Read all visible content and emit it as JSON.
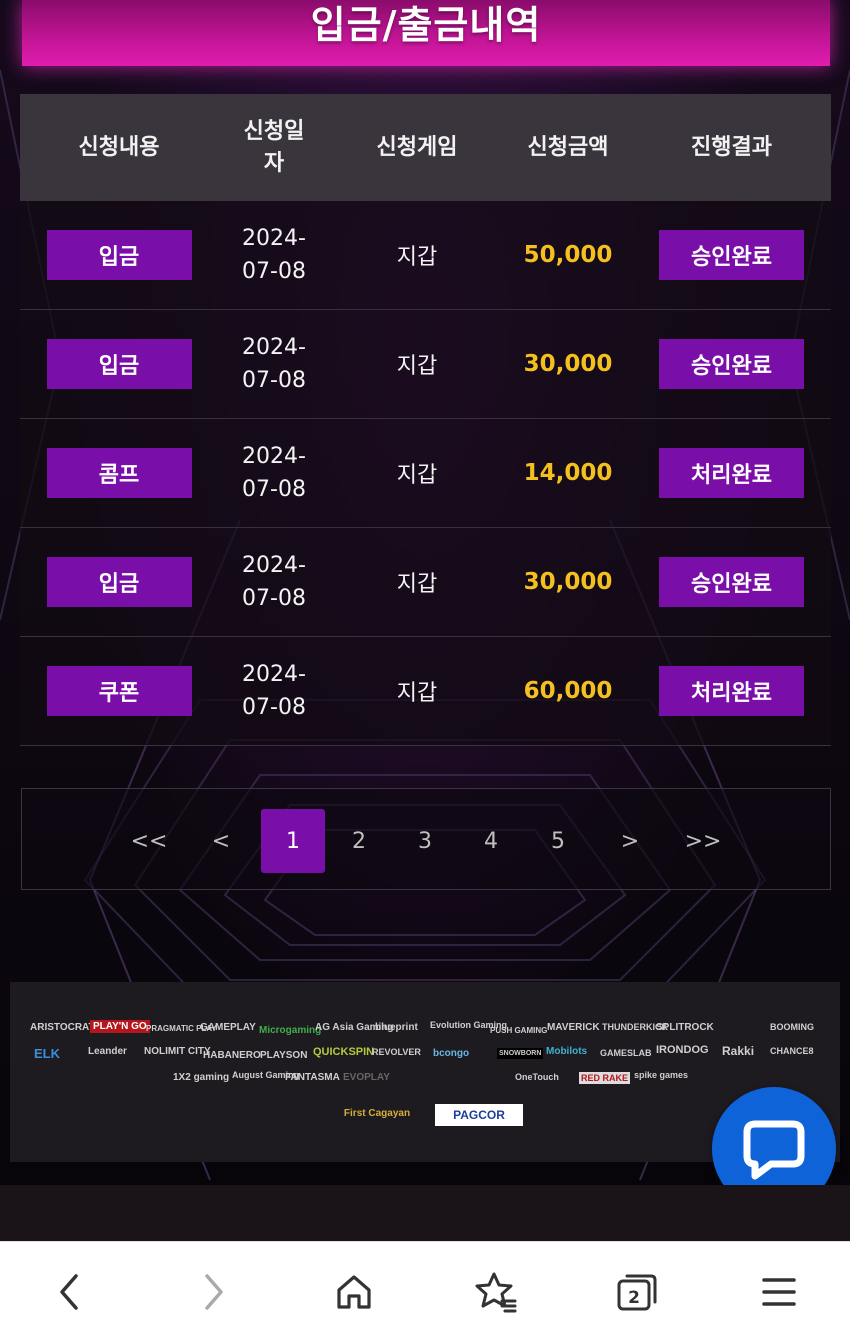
{
  "title": "입금/출금내역",
  "table": {
    "headers": [
      "신청내용",
      "신청일자",
      "신청게임",
      "신청금액",
      "진행결과"
    ],
    "rows": [
      {
        "type": "입금",
        "date": "2024-07-08",
        "game": "지갑",
        "amount": "50,000",
        "result": "승인완료"
      },
      {
        "type": "입금",
        "date": "2024-07-08",
        "game": "지갑",
        "amount": "30,000",
        "result": "승인완료"
      },
      {
        "type": "콤프",
        "date": "2024-07-08",
        "game": "지갑",
        "amount": "14,000",
        "result": "처리완료"
      },
      {
        "type": "입금",
        "date": "2024-07-08",
        "game": "지갑",
        "amount": "30,000",
        "result": "승인완료"
      },
      {
        "type": "쿠폰",
        "date": "2024-07-08",
        "game": "지갑",
        "amount": "60,000",
        "result": "처리완료"
      }
    ]
  },
  "pagination": {
    "first": "<<",
    "prev": "<",
    "pages": [
      "1",
      "2",
      "3",
      "4",
      "5"
    ],
    "current": "1",
    "next": ">",
    "last": ">>"
  },
  "partners": {
    "row1": [
      "ARISTOCRAT",
      "PLAY'N GO",
      "PRAGMATIC PLAY",
      "GAMEPLAY",
      "Microgaming",
      "AG Asia Gaming",
      "blueprint",
      "Evolution Gaming",
      "PUSH GAMING",
      "MAVERICK",
      "THUNDERKICK",
      "SPLITROCK",
      "BOOMING"
    ],
    "row2": [
      "ELK",
      "Leander",
      "NOLIMIT CITY",
      "HABANERO",
      "PLAYSON",
      "QUICKSPIN",
      "REVOLVER",
      "bcongo",
      "SNOWBORN",
      "Mobilots",
      "GAMESLAB",
      "IRONDOG",
      "Rakki",
      "CHANCE8"
    ],
    "row3": [
      "1X2 gaming",
      "August Gaming",
      "FANTASMA",
      "EVOPLAY",
      "OneTouch",
      "RED RAKE",
      "spike games"
    ],
    "licenses": [
      "First Cagayan",
      "PAGCOR"
    ]
  },
  "colors": {
    "accent": "#7a0ea8",
    "title_gradient": "#e01cae",
    "amount": "#f4c01e",
    "header_bg": "#3a343c",
    "chat_button": "#0e63d8"
  },
  "icons": {
    "chat": "chat-bubble-icon",
    "nav": [
      "back-arrow-icon",
      "forward-arrow-icon",
      "home-icon",
      "bookmark-star-icon",
      "tabs-icon",
      "menu-icon"
    ]
  },
  "browser_nav": {
    "tab_count": "2"
  }
}
